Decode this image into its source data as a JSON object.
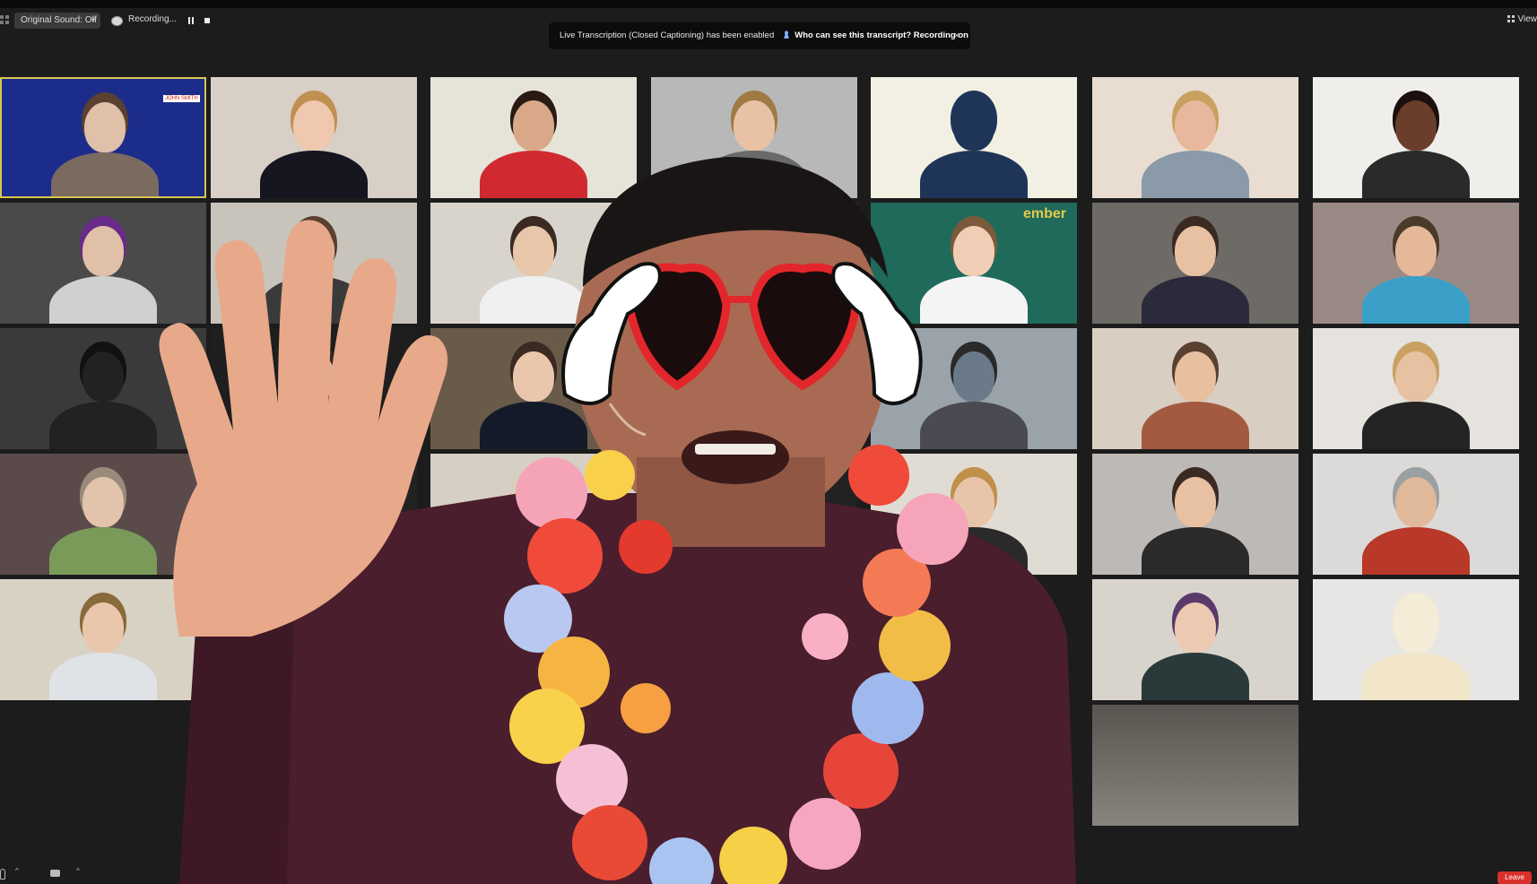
{
  "toolbar": {
    "sound_label": "Original Sound: Off",
    "recording_label": "Recording...",
    "view_label": "View"
  },
  "banner": {
    "text": "Live Transcription (Closed Captioning) has been enabled",
    "link": "Who can see this transcript? Recording on",
    "close": "×"
  },
  "bottom": {
    "leave_label": "Leave"
  },
  "tile_text": {
    "nameplate": "JOHN SMITH",
    "banner_word": "ember"
  },
  "colors": {
    "active_border": "#d9c653",
    "leave_red": "#d9302c",
    "banner_bg": "#0c0c0c"
  }
}
